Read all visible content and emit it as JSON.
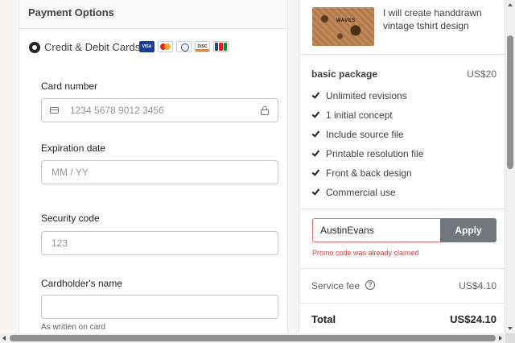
{
  "payment": {
    "title": "Payment Options",
    "method_label": "Credit & Debit Cards",
    "brands": [
      "visa-icon",
      "mastercard-icon",
      "diners-club-icon",
      "discover-icon",
      "jcb-icon"
    ],
    "card_number": {
      "label": "Card number",
      "placeholder": "1234 5678 9012 3456",
      "value": ""
    },
    "expiration": {
      "label": "Expiration date",
      "placeholder": "MM / YY",
      "value": ""
    },
    "security": {
      "label": "Security code",
      "placeholder": "123",
      "value": ""
    },
    "cardholder": {
      "label": "Cardholder's name",
      "placeholder": "",
      "value": "",
      "hint": "As written on card"
    }
  },
  "order": {
    "gig_title": "I will create handdrawn vintage tshirt design",
    "thumb_text": "WAVES",
    "package_name": "basic package",
    "package_price": "US$20",
    "features": [
      "Unlimited revisions",
      "1 initial concept",
      "Include source file",
      "Printable resolution file",
      "Front & back design",
      "Commercial use"
    ],
    "promo": {
      "value": "AustinEvans",
      "button_label": "Apply",
      "error": "Promo code was already claimed"
    },
    "service_fee_label": "Service fee",
    "service_fee_value": "US$4.10",
    "total_label": "Total",
    "total_value": "US$24.10"
  },
  "colors": {
    "error": "#d93f3f",
    "apply_button": "#74767e",
    "text_primary": "#404145"
  }
}
